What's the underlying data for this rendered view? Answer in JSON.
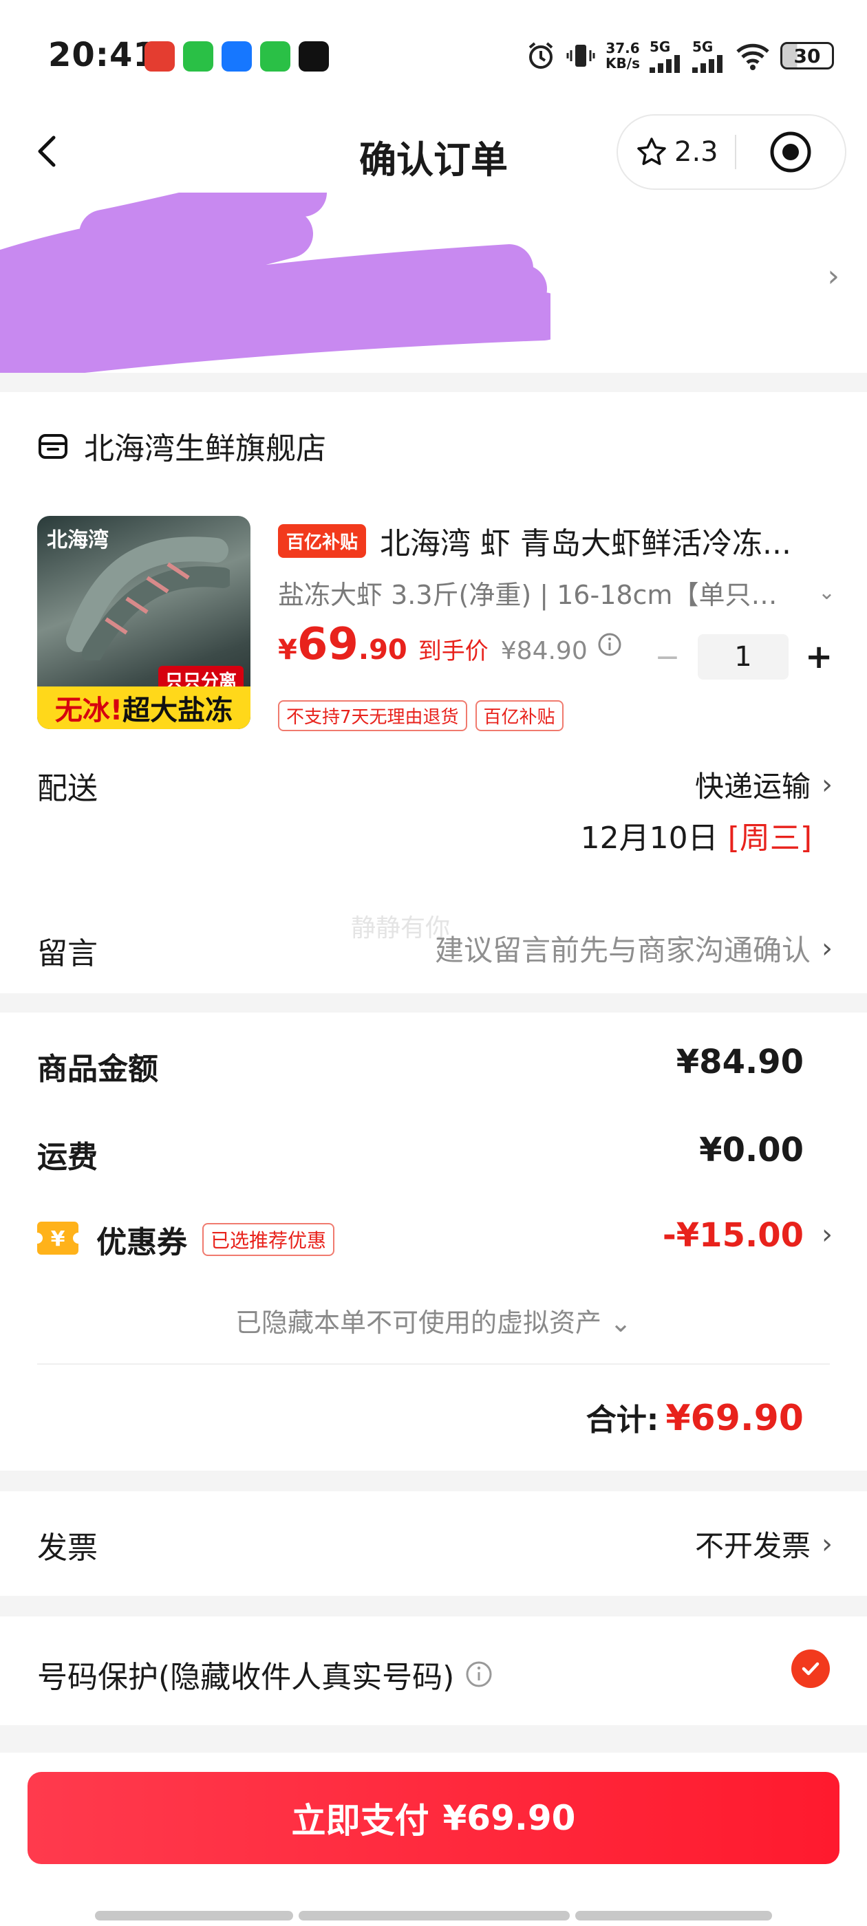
{
  "status_bar": {
    "time": "20:41",
    "net_speed_value": "37.6",
    "net_speed_unit": "KB/s",
    "sim1": "5G",
    "sim2": "5G",
    "battery": "30"
  },
  "header": {
    "title": "确认订单",
    "rating": "2.3"
  },
  "store": {
    "name": "北海湾生鲜旗舰店"
  },
  "product": {
    "badge": "百亿补贴",
    "title": "北海湾 虾 青岛大虾鲜活冷冻...",
    "sku": "盐冻大虾 3.3斤(净重) | 16-18cm【单只冻 ...",
    "price_symbol": "¥",
    "price_int": "69",
    "price_dec": ".90",
    "price_label": "到手价",
    "original_price": "¥84.90",
    "quantity": "1",
    "minus": "−",
    "plus": "+",
    "tags": [
      "不支持7天无理由退货",
      "百亿补贴"
    ],
    "image_text": {
      "logo": "北海湾",
      "tag1": "只只分离",
      "tag2_a": "无冰!",
      "tag2_b": "超大盐冻"
    }
  },
  "delivery": {
    "label": "配送",
    "method": "快递运输",
    "date": "12月10日",
    "weekday": "[周三]"
  },
  "note": {
    "label": "留言",
    "placeholder": "建议留言前先与商家沟通确认",
    "watermark": "静静有你"
  },
  "summary": {
    "goods_label": "商品金额",
    "goods_value": "¥84.90",
    "shipping_label": "运费",
    "shipping_value": "¥0.00",
    "coupon_label": "优惠券",
    "coupon_badge": "已选推荐优惠",
    "coupon_value": "-¥15.00",
    "hidden_assets": "已隐藏本单不可使用的虚拟资产",
    "total_label": "合计:",
    "total_value": "¥69.90"
  },
  "invoice": {
    "label": "发票",
    "value": "不开发票"
  },
  "protection": {
    "label": "号码保护(隐藏收件人真实号码)",
    "checked": true
  },
  "pay": {
    "label": "立即支付",
    "amount": "¥69.90"
  },
  "colors": {
    "accent": "#e8221c",
    "pay_button": "#ff2a3d",
    "scribble": "#c889f0"
  }
}
